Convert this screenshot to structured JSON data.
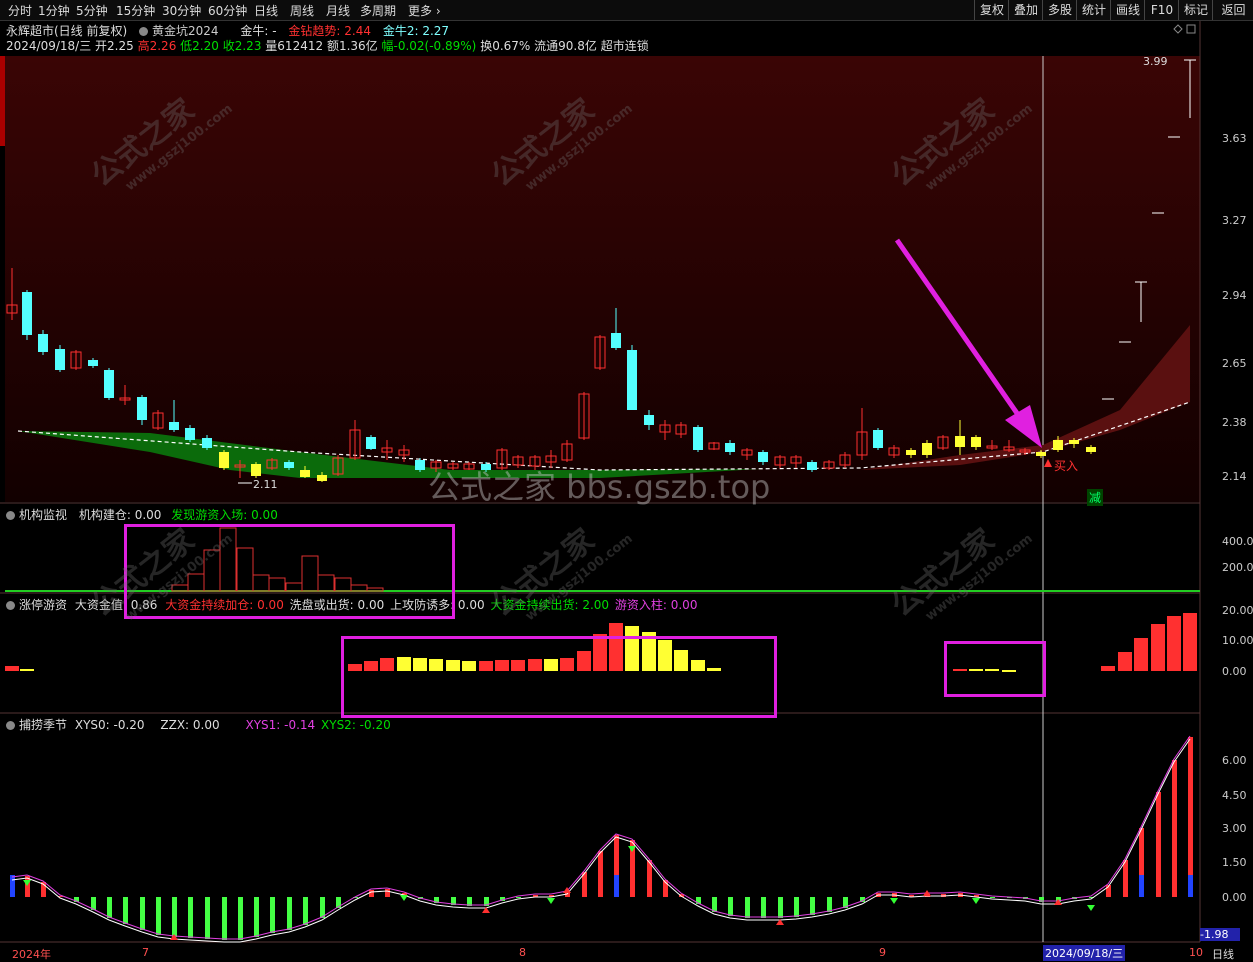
{
  "toolbar": {
    "left_items": [
      "分时",
      "1分钟",
      "5分钟",
      "15分钟",
      "30分钟",
      "60分钟",
      "日线",
      "周线",
      "月线",
      "多周期",
      "更多 ›"
    ],
    "right_items": [
      "复权",
      "叠加",
      "多股",
      "统计",
      "画线",
      "F10",
      "标记",
      "返回"
    ]
  },
  "info": {
    "stock": "永辉超市(日线 前复权)",
    "indicator": "黄金坑2024",
    "jinniu_label": "金牛: -",
    "jinzuan_label": "金钻趋势: 2.44",
    "jinniu2_label": "金牛2: 2.27",
    "date": "2024/09/18/三",
    "open": "开2.25",
    "high": "高2.26",
    "low": "低2.20",
    "close": "收2.23",
    "volume": "量612412",
    "amount": "额1.36亿",
    "change": "幅-0.02(-0.89%)",
    "turnover": "换0.67%",
    "float": "流通90.8亿",
    "sector": "超市连锁"
  },
  "main_axis": [
    "3.99",
    "3.63",
    "3.27",
    "2.94",
    "2.65",
    "2.38",
    "2.14"
  ],
  "main_annot": {
    "low_mark": "2.11",
    "buy": "买入",
    "reduce": "减",
    "watermark": "公式之家 bbs.gszb.top"
  },
  "panel2": {
    "name": "机构监视",
    "l1": "机构建仓: 0.00",
    "l2": "发现游资入场: 0.00",
    "axis": [
      "400.0",
      "200.0"
    ]
  },
  "panel3": {
    "name": "涨停游资",
    "l1": "大资金值: 0.86",
    "l2": "大资金持续加仓: 0.00",
    "l3": "洗盘或出货: 0.00",
    "l4": "上攻防诱多: 0.00",
    "l5": "大资金持续出货: 2.00",
    "l6": "游资入柱: 0.00",
    "axis": [
      "20.00",
      "10.00",
      "0.00"
    ]
  },
  "panel4": {
    "name": "捕捞季节",
    "l1": "XYS0: -0.20",
    "l2": "ZZX: 0.00",
    "l3": "XYS1: -0.14",
    "l4": "XYS2: -0.20",
    "axis": [
      "6.00",
      "4.50",
      "3.00",
      "1.50",
      "0.00"
    ],
    "cur": "-1.98"
  },
  "bottom": {
    "year": "2024年",
    "m7": "7",
    "m8": "8",
    "m9": "9",
    "date": "2024/09/18/三",
    "m10": "10",
    "period": "日线"
  },
  "watermarks": [
    "公式之家",
    "www.gszj100.com"
  ],
  "colors": {
    "up": "#ff3030",
    "down": "#54ffff",
    "yellow": "#ffff33",
    "green": "#00cc00",
    "magenta": "#e020e0"
  }
}
